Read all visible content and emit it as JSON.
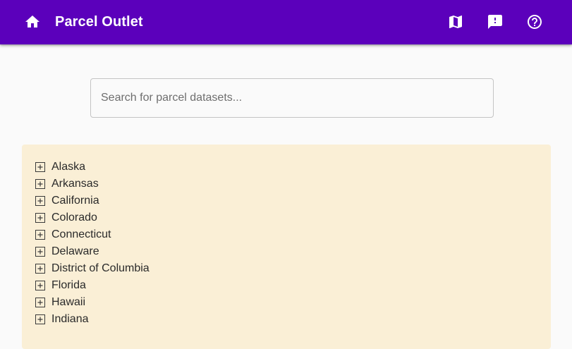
{
  "header": {
    "title": "Parcel Outlet",
    "icons": {
      "home": "home-icon",
      "map": "map-icon",
      "feedback": "feedback-icon",
      "help": "help-icon"
    },
    "colors": {
      "background": "#5b00bb",
      "foreground": "#ffffff"
    }
  },
  "search": {
    "placeholder": "Search for parcel datasets...",
    "value": ""
  },
  "tree": {
    "expand_icon": "plus-square-icon",
    "background": "#faefd6",
    "items": [
      {
        "label": "Alaska"
      },
      {
        "label": "Arkansas"
      },
      {
        "label": "California"
      },
      {
        "label": "Colorado"
      },
      {
        "label": "Connecticut"
      },
      {
        "label": "Delaware"
      },
      {
        "label": "District of Columbia"
      },
      {
        "label": "Florida"
      },
      {
        "label": "Hawaii"
      },
      {
        "label": "Indiana"
      }
    ]
  }
}
